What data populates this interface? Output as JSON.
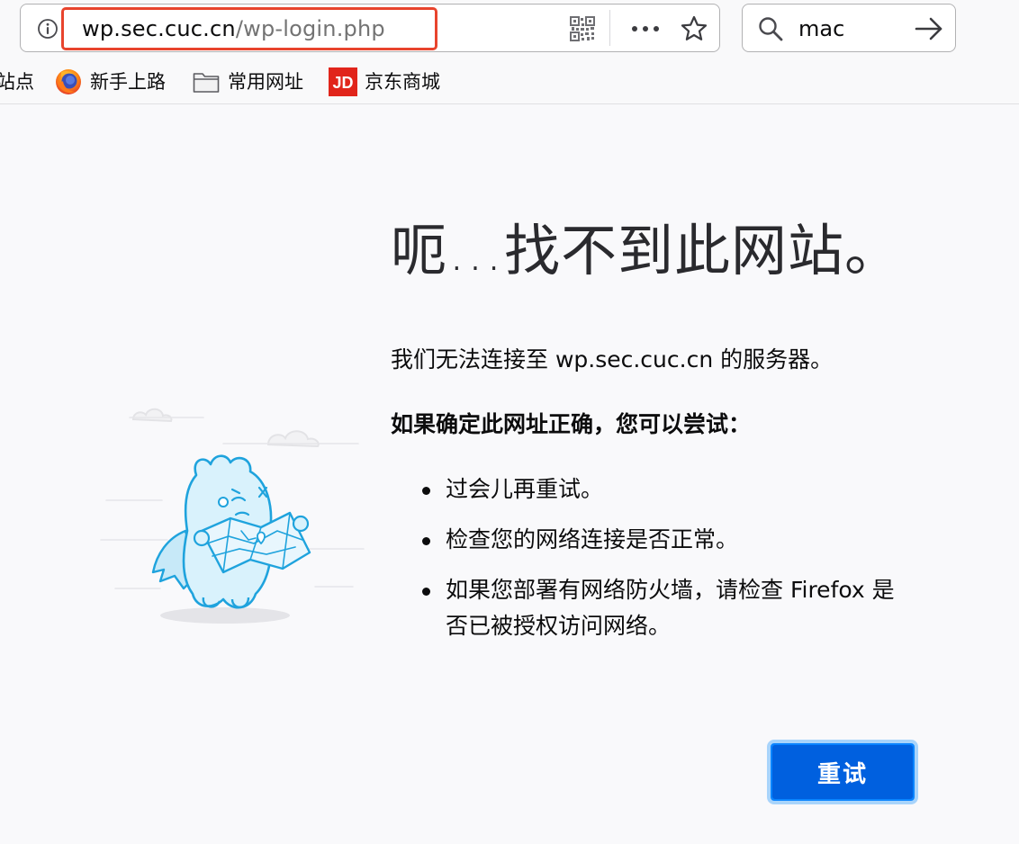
{
  "toolbar": {
    "url_host": "wp.sec.cuc.cn",
    "url_path": "/wp-login.php",
    "search_text": "mac"
  },
  "bookmarks": [
    {
      "label": "站点"
    },
    {
      "label": "新手上路"
    },
    {
      "label": "常用网址"
    },
    {
      "label": "京东商城",
      "icon_text": "JD"
    }
  ],
  "error": {
    "title": "呃…找不到此网站。",
    "description": "我们无法连接至 wp.sec.cuc.cn 的服务器。",
    "suggestion_heading": "如果确定此网址正确，您可以尝试：",
    "suggestions": [
      "过会儿再重试。",
      "检查您的网络连接是否正常。",
      "如果您部署有网络防火墙，请检查 Firefox 是否已被授权访问网络。"
    ],
    "try_again_label": "重试"
  },
  "colors": {
    "url_highlight": "#e8442d",
    "button": "#0060df",
    "illustration": "#1fa3dd"
  }
}
